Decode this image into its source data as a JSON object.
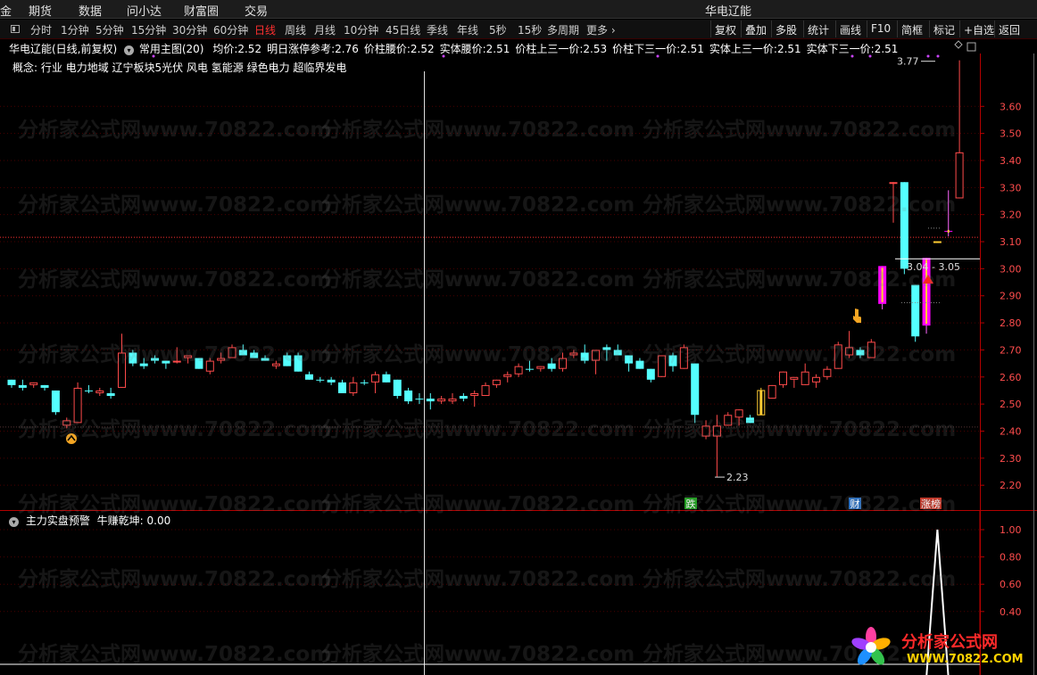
{
  "menubar": {
    "items": [
      "金",
      "期货",
      "数据",
      "问小达",
      "财富圈",
      "交易"
    ],
    "window_title": "华电辽能"
  },
  "toolbar": {
    "periods": [
      "分时",
      "1分钟",
      "5分钟",
      "15分钟",
      "30分钟",
      "60分钟",
      "日线",
      "周线",
      "月线",
      "10分钟",
      "45日线",
      "季线",
      "年线",
      "5秒",
      "15秒",
      "多周期",
      "更多 ›"
    ],
    "active_period": "日线",
    "right_buttons": [
      "复权",
      "叠加",
      "多股",
      "统计",
      "画线",
      "F10",
      "简框",
      "标记",
      "+自选",
      "返回"
    ]
  },
  "header": {
    "stock": "华电辽能(日线,前复权)",
    "formula": "常用主图(20)",
    "stats": [
      {
        "label": "均价:",
        "value": "2.52"
      },
      {
        "label": "明日涨停参考:",
        "value": "2.76"
      },
      {
        "label": "价柱腰价:",
        "value": "2.52"
      },
      {
        "label": "实体腰价:",
        "value": "2.51"
      },
      {
        "label": "价柱上三一价:",
        "value": "2.53"
      },
      {
        "label": "价柱下三一价:",
        "value": "2.51"
      },
      {
        "label": "实体上三一价:",
        "value": "2.51"
      },
      {
        "label": "实体下三一价:",
        "value": "2.51"
      }
    ],
    "concepts_label": "概念:",
    "concepts": "行业 电力地域 辽宁板块5光伏 风电 氢能源 绿色电力 超临界发电"
  },
  "indicator": {
    "name": "主力实盘预警",
    "series_label": "牛赚乾坤:",
    "series_value": "0.00",
    "axis_ticks": [
      "1.00",
      "0.80",
      "0.60",
      "0.40"
    ]
  },
  "price_axis": {
    "ticks": [
      "3.60",
      "3.50",
      "3.40",
      "3.30",
      "3.20",
      "3.10",
      "3.00",
      "2.90",
      "2.80",
      "2.70",
      "2.60",
      "2.50",
      "2.40",
      "2.30",
      "2.20"
    ]
  },
  "annotations": {
    "high_label": "3.77",
    "low_label": "2.23",
    "range_label": "3.04 - 3.05",
    "badges": [
      {
        "text": "跌",
        "color": "#1fa01f"
      },
      {
        "text": "财",
        "color": "#2a6fc0"
      },
      {
        "text": "涨榜",
        "color": "#c0392b"
      }
    ]
  },
  "watermark": {
    "text": "分析家公式网www.70822.com",
    "logo_title": "分析家公式网",
    "logo_url": "WWW.70822.COM"
  },
  "colors": {
    "up": "#ff4a4a",
    "down": "#54ffff",
    "gold": "#ffcc33",
    "magenta": "#ff00ff",
    "axis": "#b40000"
  },
  "chart_data": {
    "type": "candlestick",
    "ylim": [
      2.17,
      3.82
    ],
    "y_ticks": [
      3.6,
      3.5,
      3.4,
      3.3,
      3.2,
      3.1,
      3.0,
      2.9,
      2.8,
      2.7,
      2.6,
      2.5,
      2.4,
      2.3,
      2.2
    ],
    "candles": [
      [
        2.59,
        2.59,
        2.56,
        2.57,
        "c"
      ],
      [
        2.57,
        2.59,
        2.55,
        2.56,
        "c"
      ],
      [
        2.57,
        2.58,
        2.56,
        2.58,
        "w"
      ],
      [
        2.57,
        2.57,
        2.55,
        2.56,
        "c"
      ],
      [
        2.55,
        2.55,
        2.46,
        2.47,
        "c"
      ],
      [
        2.42,
        2.45,
        2.41,
        2.44,
        "w"
      ],
      [
        2.43,
        2.58,
        2.43,
        2.56,
        "w"
      ],
      [
        2.55,
        2.57,
        2.54,
        2.55,
        "c"
      ],
      [
        2.55,
        2.56,
        2.53,
        2.54,
        "w"
      ],
      [
        2.54,
        2.56,
        2.52,
        2.53,
        "c"
      ],
      [
        2.56,
        2.76,
        2.56,
        2.69,
        "w"
      ],
      [
        2.69,
        2.7,
        2.64,
        2.65,
        "c"
      ],
      [
        2.65,
        2.67,
        2.63,
        2.64,
        "c"
      ],
      [
        2.66,
        2.68,
        2.65,
        2.67,
        "c"
      ],
      [
        2.65,
        2.66,
        2.63,
        2.66,
        "c"
      ],
      [
        2.66,
        2.71,
        2.65,
        2.66,
        "w"
      ],
      [
        2.68,
        2.68,
        2.65,
        2.67,
        "w"
      ],
      [
        2.67,
        2.67,
        2.63,
        2.63,
        "c"
      ],
      [
        2.62,
        2.67,
        2.61,
        2.66,
        "w"
      ],
      [
        2.66,
        2.69,
        2.65,
        2.67,
        "w"
      ],
      [
        2.67,
        2.72,
        2.67,
        2.71,
        "w"
      ],
      [
        2.7,
        2.72,
        2.68,
        2.68,
        "c"
      ],
      [
        2.69,
        2.7,
        2.67,
        2.67,
        "c"
      ],
      [
        2.67,
        2.68,
        2.66,
        2.66,
        "c"
      ],
      [
        2.64,
        2.66,
        2.63,
        2.65,
        "w"
      ],
      [
        2.68,
        2.69,
        2.64,
        2.64,
        "c"
      ],
      [
        2.68,
        2.69,
        2.62,
        2.62,
        "c"
      ],
      [
        2.61,
        2.62,
        2.59,
        2.59,
        "c"
      ],
      [
        2.59,
        2.6,
        2.58,
        2.59,
        "c"
      ],
      [
        2.59,
        2.6,
        2.57,
        2.58,
        "c"
      ],
      [
        2.58,
        2.59,
        2.54,
        2.54,
        "c"
      ],
      [
        2.54,
        2.6,
        2.53,
        2.58,
        "w"
      ],
      [
        2.58,
        2.59,
        2.57,
        2.58,
        "c"
      ],
      [
        2.58,
        2.62,
        2.54,
        2.61,
        "w"
      ],
      [
        2.61,
        2.62,
        2.58,
        2.58,
        "c"
      ],
      [
        2.59,
        2.59,
        2.52,
        2.53,
        "c"
      ],
      [
        2.55,
        2.56,
        2.5,
        2.51,
        "c"
      ],
      [
        2.52,
        2.54,
        2.5,
        2.52,
        "c"
      ],
      [
        2.52,
        2.54,
        2.48,
        2.51,
        "c"
      ],
      [
        2.52,
        2.53,
        2.5,
        2.51,
        "w"
      ],
      [
        2.51,
        2.54,
        2.5,
        2.52,
        "w"
      ],
      [
        2.52,
        2.54,
        2.51,
        2.53,
        "c"
      ],
      [
        2.54,
        2.55,
        2.49,
        2.53,
        "w"
      ],
      [
        2.53,
        2.58,
        2.53,
        2.57,
        "w"
      ],
      [
        2.57,
        2.59,
        2.56,
        2.59,
        "w"
      ],
      [
        2.6,
        2.62,
        2.58,
        2.61,
        "w"
      ],
      [
        2.61,
        2.65,
        2.6,
        2.64,
        "w"
      ],
      [
        2.63,
        2.66,
        2.62,
        2.63,
        "c"
      ],
      [
        2.63,
        2.64,
        2.62,
        2.64,
        "w"
      ],
      [
        2.65,
        2.67,
        2.62,
        2.63,
        "c"
      ],
      [
        2.63,
        2.69,
        2.62,
        2.67,
        "w"
      ],
      [
        2.68,
        2.7,
        2.67,
        2.69,
        "w"
      ],
      [
        2.69,
        2.72,
        2.65,
        2.66,
        "c"
      ],
      [
        2.66,
        2.7,
        2.61,
        2.7,
        "w"
      ],
      [
        2.71,
        2.72,
        2.66,
        2.7,
        "c"
      ],
      [
        2.7,
        2.72,
        2.68,
        2.68,
        "c"
      ],
      [
        2.68,
        2.68,
        2.62,
        2.65,
        "c"
      ],
      [
        2.66,
        2.67,
        2.63,
        2.63,
        "c"
      ],
      [
        2.63,
        2.63,
        2.58,
        2.59,
        "c"
      ],
      [
        2.6,
        2.68,
        2.6,
        2.68,
        "w"
      ],
      [
        2.68,
        2.69,
        2.62,
        2.64,
        "c"
      ],
      [
        2.63,
        2.72,
        2.63,
        2.71,
        "w"
      ],
      [
        2.65,
        2.65,
        2.43,
        2.46,
        "c"
      ],
      [
        2.38,
        2.44,
        2.37,
        2.42,
        "w"
      ],
      [
        2.42,
        2.46,
        2.23,
        2.38,
        "w"
      ],
      [
        2.42,
        2.47,
        2.42,
        2.46,
        "w"
      ],
      [
        2.45,
        2.48,
        2.42,
        2.48,
        "w"
      ],
      [
        2.45,
        2.46,
        2.43,
        2.43,
        "c"
      ],
      [
        2.46,
        2.56,
        2.46,
        2.55,
        "y"
      ],
      [
        2.52,
        2.57,
        2.52,
        2.57,
        "w"
      ],
      [
        2.57,
        2.62,
        2.56,
        2.62,
        "w"
      ],
      [
        2.59,
        2.6,
        2.56,
        2.6,
        "w"
      ],
      [
        2.57,
        2.65,
        2.57,
        2.62,
        "w"
      ],
      [
        2.6,
        2.61,
        2.56,
        2.58,
        "w"
      ],
      [
        2.6,
        2.64,
        2.59,
        2.63,
        "w"
      ],
      [
        2.63,
        2.73,
        2.63,
        2.72,
        "w"
      ],
      [
        2.68,
        2.77,
        2.67,
        2.71,
        "w"
      ],
      [
        2.7,
        2.71,
        2.67,
        2.68,
        "c"
      ],
      [
        2.67,
        2.74,
        2.67,
        2.73,
        "w"
      ],
      [
        2.87,
        3.01,
        2.85,
        3.01,
        "m"
      ],
      [
        3.32,
        3.32,
        3.17,
        3.32,
        "w"
      ],
      [
        3.0,
        3.32,
        2.98,
        3.32,
        "c"
      ],
      [
        2.94,
        2.94,
        2.73,
        2.75,
        "c"
      ],
      [
        2.79,
        3.04,
        2.76,
        3.04,
        "m"
      ],
      [
        3.1,
        3.1,
        3.1,
        3.1,
        "y"
      ],
      [
        3.14,
        3.29,
        3.12,
        3.14,
        "m"
      ],
      [
        3.26,
        3.77,
        3.26,
        3.43,
        "w"
      ]
    ],
    "indicator": {
      "name": "牛赚乾坤",
      "values": [
        0,
        0,
        0,
        0,
        0,
        0,
        0,
        0,
        0,
        0,
        0,
        0,
        0,
        0,
        0,
        0,
        0,
        0,
        0,
        0,
        0,
        0,
        0,
        0,
        0,
        0,
        0,
        0,
        0,
        0,
        0,
        0,
        0,
        0,
        0,
        0,
        0,
        0,
        0,
        0,
        0,
        0,
        0,
        0,
        0,
        0,
        0,
        0,
        0,
        0,
        0,
        0,
        0,
        0,
        0,
        0,
        0,
        0,
        0,
        0,
        0,
        0,
        0,
        0,
        0,
        0,
        0,
        0,
        0,
        0,
        0,
        0,
        0,
        0,
        0,
        0,
        0,
        0,
        0,
        0,
        0,
        0,
        0,
        0,
        1,
        0,
        0
      ],
      "ylim": [
        0.3,
        1.08
      ]
    }
  }
}
